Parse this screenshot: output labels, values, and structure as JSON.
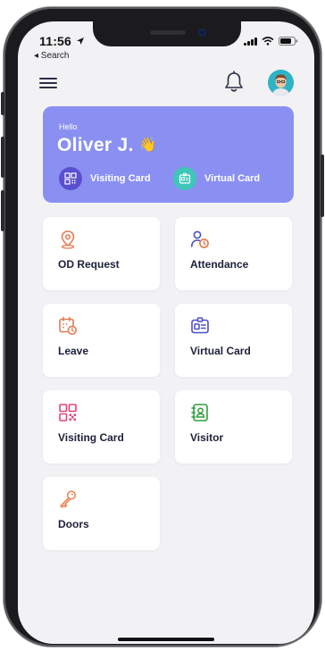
{
  "status_bar": {
    "time": "11:56",
    "back_label": "◂ Search"
  },
  "header": {
    "menu_icon": "hamburger-menu-icon",
    "bell_icon": "bell-icon",
    "avatar_icon": "user-avatar"
  },
  "hero": {
    "greeting": "Hello",
    "name": "Oliver J.",
    "wave_emoji": "👋",
    "chips": [
      {
        "label": "Visiting Card",
        "icon": "qr-code-icon",
        "color": "#5a4fcf"
      },
      {
        "label": "Virtual Card",
        "icon": "id-card-icon",
        "color": "#3ec7b8"
      }
    ],
    "background": "#8a90f1"
  },
  "grid": [
    {
      "label": "OD Request",
      "icon": "map-pin-icon",
      "color": "#e57b52"
    },
    {
      "label": "Attendance",
      "icon": "user-clock-icon",
      "color": "#4a4fc4"
    },
    {
      "label": "Leave",
      "icon": "calendar-clock-icon",
      "color": "#e57b52"
    },
    {
      "label": "Virtual Card",
      "icon": "id-card-icon",
      "color": "#4a4fc4"
    },
    {
      "label": "Visiting Card",
      "icon": "qr-code-icon",
      "color": "#e0457b"
    },
    {
      "label": "Visitor",
      "icon": "contact-book-icon",
      "color": "#2f9e3e"
    },
    {
      "label": "Doors",
      "icon": "key-icon",
      "color": "#e98a5a"
    }
  ]
}
